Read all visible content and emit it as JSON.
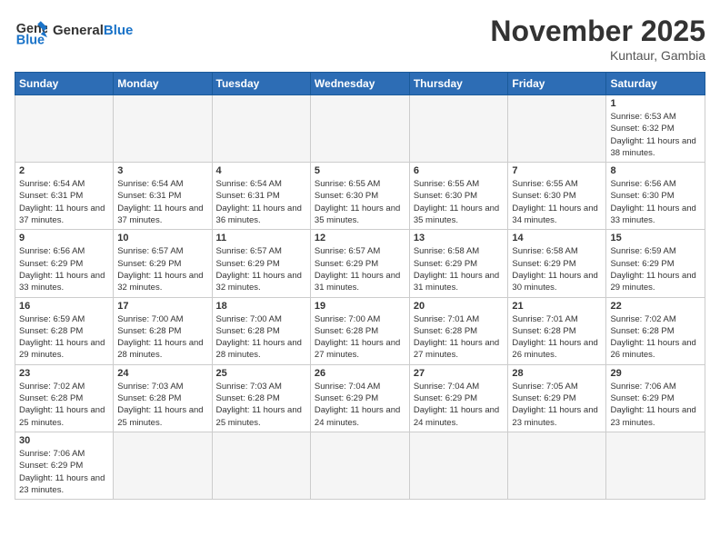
{
  "header": {
    "logo_general": "General",
    "logo_blue": "Blue",
    "month_title": "November 2025",
    "location": "Kuntaur, Gambia"
  },
  "days_of_week": [
    "Sunday",
    "Monday",
    "Tuesday",
    "Wednesday",
    "Thursday",
    "Friday",
    "Saturday"
  ],
  "weeks": [
    [
      {
        "day": "",
        "info": ""
      },
      {
        "day": "",
        "info": ""
      },
      {
        "day": "",
        "info": ""
      },
      {
        "day": "",
        "info": ""
      },
      {
        "day": "",
        "info": ""
      },
      {
        "day": "",
        "info": ""
      },
      {
        "day": "1",
        "info": "Sunrise: 6:53 AM\nSunset: 6:32 PM\nDaylight: 11 hours and 38 minutes."
      }
    ],
    [
      {
        "day": "2",
        "info": "Sunrise: 6:54 AM\nSunset: 6:31 PM\nDaylight: 11 hours and 37 minutes."
      },
      {
        "day": "3",
        "info": "Sunrise: 6:54 AM\nSunset: 6:31 PM\nDaylight: 11 hours and 37 minutes."
      },
      {
        "day": "4",
        "info": "Sunrise: 6:54 AM\nSunset: 6:31 PM\nDaylight: 11 hours and 36 minutes."
      },
      {
        "day": "5",
        "info": "Sunrise: 6:55 AM\nSunset: 6:30 PM\nDaylight: 11 hours and 35 minutes."
      },
      {
        "day": "6",
        "info": "Sunrise: 6:55 AM\nSunset: 6:30 PM\nDaylight: 11 hours and 35 minutes."
      },
      {
        "day": "7",
        "info": "Sunrise: 6:55 AM\nSunset: 6:30 PM\nDaylight: 11 hours and 34 minutes."
      },
      {
        "day": "8",
        "info": "Sunrise: 6:56 AM\nSunset: 6:30 PM\nDaylight: 11 hours and 33 minutes."
      }
    ],
    [
      {
        "day": "9",
        "info": "Sunrise: 6:56 AM\nSunset: 6:29 PM\nDaylight: 11 hours and 33 minutes."
      },
      {
        "day": "10",
        "info": "Sunrise: 6:57 AM\nSunset: 6:29 PM\nDaylight: 11 hours and 32 minutes."
      },
      {
        "day": "11",
        "info": "Sunrise: 6:57 AM\nSunset: 6:29 PM\nDaylight: 11 hours and 32 minutes."
      },
      {
        "day": "12",
        "info": "Sunrise: 6:57 AM\nSunset: 6:29 PM\nDaylight: 11 hours and 31 minutes."
      },
      {
        "day": "13",
        "info": "Sunrise: 6:58 AM\nSunset: 6:29 PM\nDaylight: 11 hours and 31 minutes."
      },
      {
        "day": "14",
        "info": "Sunrise: 6:58 AM\nSunset: 6:29 PM\nDaylight: 11 hours and 30 minutes."
      },
      {
        "day": "15",
        "info": "Sunrise: 6:59 AM\nSunset: 6:29 PM\nDaylight: 11 hours and 29 minutes."
      }
    ],
    [
      {
        "day": "16",
        "info": "Sunrise: 6:59 AM\nSunset: 6:28 PM\nDaylight: 11 hours and 29 minutes."
      },
      {
        "day": "17",
        "info": "Sunrise: 7:00 AM\nSunset: 6:28 PM\nDaylight: 11 hours and 28 minutes."
      },
      {
        "day": "18",
        "info": "Sunrise: 7:00 AM\nSunset: 6:28 PM\nDaylight: 11 hours and 28 minutes."
      },
      {
        "day": "19",
        "info": "Sunrise: 7:00 AM\nSunset: 6:28 PM\nDaylight: 11 hours and 27 minutes."
      },
      {
        "day": "20",
        "info": "Sunrise: 7:01 AM\nSunset: 6:28 PM\nDaylight: 11 hours and 27 minutes."
      },
      {
        "day": "21",
        "info": "Sunrise: 7:01 AM\nSunset: 6:28 PM\nDaylight: 11 hours and 26 minutes."
      },
      {
        "day": "22",
        "info": "Sunrise: 7:02 AM\nSunset: 6:28 PM\nDaylight: 11 hours and 26 minutes."
      }
    ],
    [
      {
        "day": "23",
        "info": "Sunrise: 7:02 AM\nSunset: 6:28 PM\nDaylight: 11 hours and 25 minutes."
      },
      {
        "day": "24",
        "info": "Sunrise: 7:03 AM\nSunset: 6:28 PM\nDaylight: 11 hours and 25 minutes."
      },
      {
        "day": "25",
        "info": "Sunrise: 7:03 AM\nSunset: 6:28 PM\nDaylight: 11 hours and 25 minutes."
      },
      {
        "day": "26",
        "info": "Sunrise: 7:04 AM\nSunset: 6:29 PM\nDaylight: 11 hours and 24 minutes."
      },
      {
        "day": "27",
        "info": "Sunrise: 7:04 AM\nSunset: 6:29 PM\nDaylight: 11 hours and 24 minutes."
      },
      {
        "day": "28",
        "info": "Sunrise: 7:05 AM\nSunset: 6:29 PM\nDaylight: 11 hours and 23 minutes."
      },
      {
        "day": "29",
        "info": "Sunrise: 7:06 AM\nSunset: 6:29 PM\nDaylight: 11 hours and 23 minutes."
      }
    ],
    [
      {
        "day": "30",
        "info": "Sunrise: 7:06 AM\nSunset: 6:29 PM\nDaylight: 11 hours and 23 minutes."
      },
      {
        "day": "",
        "info": ""
      },
      {
        "day": "",
        "info": ""
      },
      {
        "day": "",
        "info": ""
      },
      {
        "day": "",
        "info": ""
      },
      {
        "day": "",
        "info": ""
      },
      {
        "day": "",
        "info": ""
      }
    ]
  ]
}
